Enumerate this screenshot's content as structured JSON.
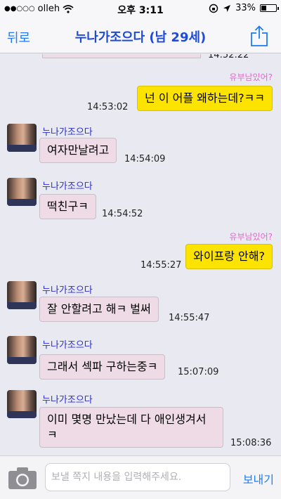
{
  "status_bar": {
    "carrier": "olleh",
    "time": "오후 3:11",
    "battery_pct": "33%",
    "battery_level": 0.33
  },
  "nav": {
    "back_label": "뒤로",
    "title": "누나가조으다 (남 29세)"
  },
  "messages": {
    "partial_time": "14:52:22",
    "m1": {
      "label": "유부남있어?",
      "text": "넌 이 어플 왜하는데?ㅋㅋ",
      "time": "14:53:02"
    },
    "m2": {
      "sender": "누나가조으다",
      "text": "여자만날려고",
      "time": "14:54:09"
    },
    "m3": {
      "sender": "누나가조으다",
      "text": "떡친구ㅋ",
      "time": "14:54:52"
    },
    "m4": {
      "label": "유부남있어?",
      "text": "와이프랑 안해?",
      "time": "14:55:27"
    },
    "m5": {
      "sender": "누나가조으다",
      "text": "잘 안할려고 해ㅋ 벌써",
      "time": "14:55:47"
    },
    "m6": {
      "sender": "누나가조으다",
      "text": "그래서 섹파 구하는중ㅋ",
      "time": "15:07:09"
    },
    "m7": {
      "sender": "누나가조으다",
      "line1": "이미 몇명 만났는데 다 애인생겨서",
      "line2": "ㅋ",
      "time": "15:08:36"
    }
  },
  "composer": {
    "placeholder": "보낼 쪽지 내용을 입력해주세요.",
    "send_label": "보내기"
  },
  "colors": {
    "incoming_bubble": "#eedbe6",
    "outgoing_bubble": "#fde400",
    "accent": "#1f7cf4",
    "title": "#1f4ad8",
    "sender_name": "#2b2bd0",
    "my_label": "#e06ac8"
  },
  "icons": [
    "signal-dots-icon",
    "wifi-icon",
    "lock-rotation-icon",
    "location-icon",
    "battery-icon",
    "share-icon",
    "camera-icon"
  ]
}
